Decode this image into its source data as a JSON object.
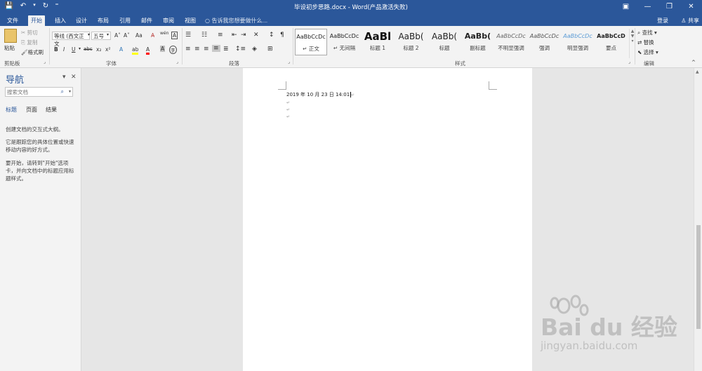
{
  "titlebar": {
    "doc_title": "毕设初步思路.docx - Word(产品激活失败)",
    "qat": {
      "save": "💾",
      "undo": "↶",
      "undo_drop": "▾",
      "redo": "↻",
      "custom": "⁼"
    },
    "win": {
      "restore_ribbon": "▣",
      "minimize": "—",
      "maximize": "❐",
      "close": "✕"
    }
  },
  "tabs": [
    "文件",
    "开始",
    "插入",
    "设计",
    "布局",
    "引用",
    "邮件",
    "审阅",
    "视图"
  ],
  "tellme": "告诉我您想要做什么...",
  "account": {
    "login": "登录",
    "share": "共享"
  },
  "ribbon": {
    "clipboard": {
      "paste": "粘贴",
      "cut": "剪切",
      "copy": "复制",
      "format_painter": "格式刷",
      "label": "剪贴板"
    },
    "font": {
      "name": "等线 (西文正文",
      "size": "五号",
      "grow": "A˄",
      "shrink": "A˅",
      "change_case": "Aa",
      "clear": "A̶",
      "phonetic": "wén",
      "border_char": "A",
      "bold": "B",
      "italic": "I",
      "underline": "U",
      "strike": "abc",
      "sub": "x₂",
      "sup": "x²",
      "effects": "A",
      "highlight": "ab",
      "color": "A",
      "shade": "A",
      "enclose": "字",
      "label": "字体"
    },
    "paragraph": {
      "label": "段落",
      "sort": "↕",
      "marks": "¶"
    },
    "styles": {
      "label": "样式",
      "items": [
        {
          "preview": "AaBbCcDc",
          "name": "↵ 正文",
          "color": "#222222",
          "weight": "normal",
          "style": "normal"
        },
        {
          "preview": "AaBbCcDc",
          "name": "↵ 无间隔",
          "color": "#222222",
          "weight": "normal",
          "style": "normal"
        },
        {
          "preview": "AaBl",
          "name": "标题 1",
          "color": "#111111",
          "weight": "bold",
          "style": "normal"
        },
        {
          "preview": "AaBb(",
          "name": "标题 2",
          "color": "#222222",
          "weight": "normal",
          "style": "normal"
        },
        {
          "preview": "AaBb(",
          "name": "标题",
          "color": "#222222",
          "weight": "normal",
          "style": "normal"
        },
        {
          "preview": "AaBb(",
          "name": "副标题",
          "color": "#222222",
          "weight": "bold",
          "style": "normal"
        },
        {
          "preview": "AaBbCcDc",
          "name": "不明显强调",
          "color": "#666666",
          "weight": "normal",
          "style": "italic"
        },
        {
          "preview": "AaBbCcDc",
          "name": "强调",
          "color": "#555555",
          "weight": "normal",
          "style": "italic"
        },
        {
          "preview": "AaBbCcDc",
          "name": "明显强调",
          "color": "#5b9bd5",
          "weight": "normal",
          "style": "italic"
        },
        {
          "preview": "AaBbCcD",
          "name": "要点",
          "color": "#222222",
          "weight": "bold",
          "style": "normal"
        }
      ]
    },
    "editing": {
      "find": "查找",
      "replace": "替换",
      "select": "选择",
      "label": "编辑"
    }
  },
  "nav": {
    "title": "导航",
    "search_placeholder": "搜索文档",
    "tabs": [
      "标题",
      "页面",
      "结果"
    ],
    "para1": "创建文档的交互式大纲。",
    "para2": "它是跟踪您的具体位置或快速移动内容的好方式。",
    "para3": "要开始，请转到\"开始\"选项卡，并向文档中的标题应用标题样式。"
  },
  "document": {
    "line1": "2019 年 10 月 23 日 14:01",
    "para_mark": "↵"
  },
  "watermark": {
    "brand": "Bai du 经验",
    "url": "jingyan.baidu.com"
  },
  "colors": {
    "accent": "#2b579a",
    "ribbon_bg": "#f3f3f3",
    "canvas_bg": "#e6e6e6"
  }
}
